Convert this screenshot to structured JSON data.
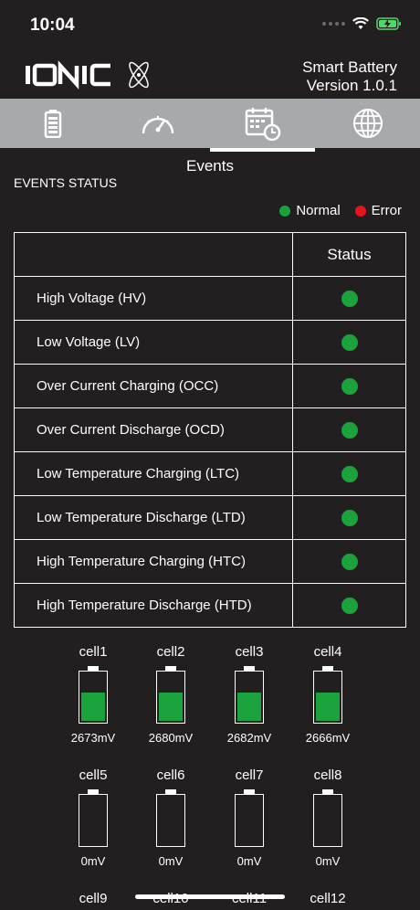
{
  "status_bar": {
    "time": "10:04"
  },
  "header": {
    "logo_text": "IONIC",
    "app_name": "Smart Battery",
    "version": "Version 1.0.1"
  },
  "tabs": [
    {
      "icon": "battery-icon"
    },
    {
      "icon": "speedometer-icon"
    },
    {
      "icon": "calendar-clock-icon",
      "active": true
    },
    {
      "icon": "globe-icon"
    }
  ],
  "active_tab_label": "Events",
  "section_title": "EVENTS STATUS",
  "legend": {
    "normal_label": "Normal",
    "normal_color": "#1aa33d",
    "error_label": "Error",
    "error_color": "#e8141b"
  },
  "table": {
    "status_header": "Status",
    "rows": [
      {
        "name": "High Voltage (HV)",
        "status": "normal"
      },
      {
        "name": "Low Voltage (LV)",
        "status": "normal"
      },
      {
        "name": "Over Current Charging (OCC)",
        "status": "normal"
      },
      {
        "name": "Over Current Discharge (OCD)",
        "status": "normal"
      },
      {
        "name": "Low Temperature Charging (LTC)",
        "status": "normal"
      },
      {
        "name": "Low Temperature Discharge (LTD)",
        "status": "normal"
      },
      {
        "name": "High Temperature Charging (HTC)",
        "status": "normal"
      },
      {
        "name": "High Temperature Discharge (HTD)",
        "status": "normal"
      }
    ]
  },
  "cells": [
    {
      "name": "cell1",
      "voltage": "2673mV",
      "level": 0.55
    },
    {
      "name": "cell2",
      "voltage": "2680mV",
      "level": 0.55
    },
    {
      "name": "cell3",
      "voltage": "2682mV",
      "level": 0.55
    },
    {
      "name": "cell4",
      "voltage": "2666mV",
      "level": 0.55
    },
    {
      "name": "cell5",
      "voltage": "0mV",
      "level": 0
    },
    {
      "name": "cell6",
      "voltage": "0mV",
      "level": 0
    },
    {
      "name": "cell7",
      "voltage": "0mV",
      "level": 0
    },
    {
      "name": "cell8",
      "voltage": "0mV",
      "level": 0
    },
    {
      "name": "cell9",
      "voltage": "",
      "level": 0
    },
    {
      "name": "cell10",
      "voltage": "",
      "level": 0
    },
    {
      "name": "cell11",
      "voltage": "",
      "level": 0
    },
    {
      "name": "cell12",
      "voltage": "",
      "level": 0
    }
  ]
}
